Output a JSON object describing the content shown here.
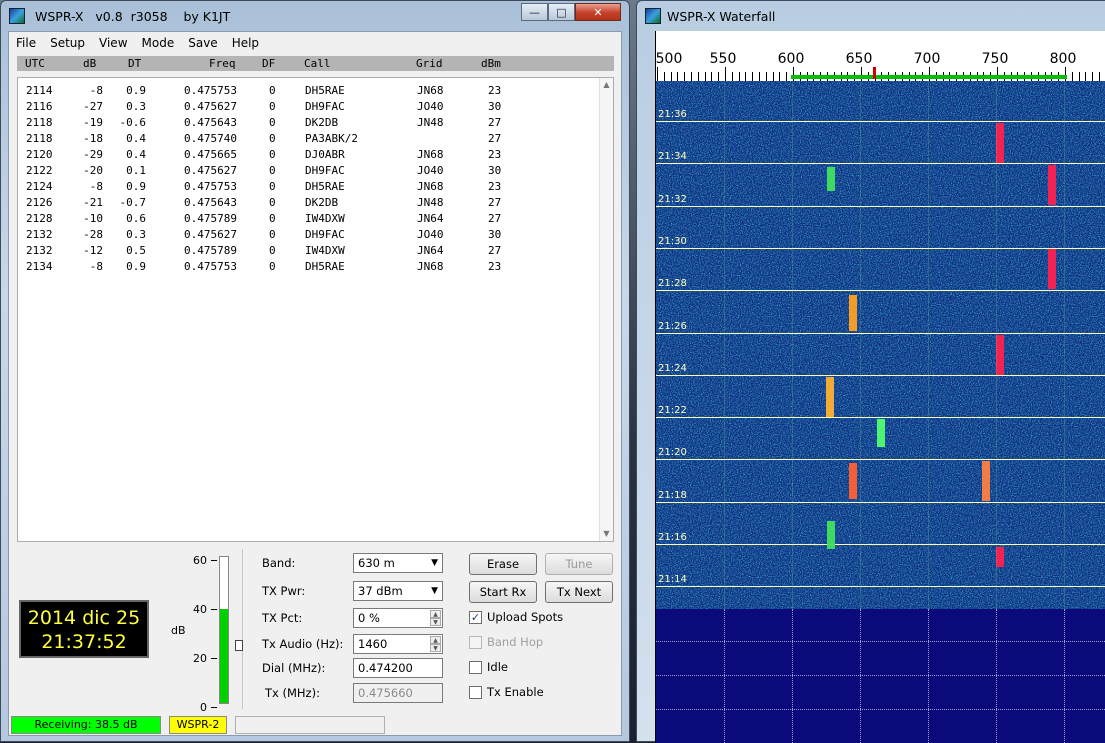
{
  "main_window": {
    "title": "WSPR-X   v0.8  r3058    by K1JT",
    "menu": [
      "File",
      "Setup",
      "View",
      "Mode",
      "Save",
      "Help"
    ],
    "columns": [
      "UTC",
      "dB",
      "DT",
      "Freq",
      "DF",
      "Call",
      "Grid",
      "dBm"
    ],
    "rows": [
      [
        "2114",
        "-8",
        "0.9",
        "0.475753",
        "0",
        "DH5RAE",
        "JN68",
        "23"
      ],
      [
        "2116",
        "-27",
        "0.3",
        "0.475627",
        "0",
        "DH9FAC",
        "JO40",
        "30"
      ],
      [
        "2118",
        "-19",
        "-0.6",
        "0.475643",
        "0",
        "DK2DB",
        "JN48",
        "27"
      ],
      [
        "2118",
        "-18",
        "0.4",
        "0.475740",
        "0",
        "PA3ABK/2",
        "",
        "27"
      ],
      [
        "2120",
        "-29",
        "0.4",
        "0.475665",
        "0",
        "DJ0ABR",
        "JN68",
        "23"
      ],
      [
        "2122",
        "-20",
        "0.1",
        "0.475627",
        "0",
        "DH9FAC",
        "JO40",
        "30"
      ],
      [
        "2124",
        "-8",
        "0.9",
        "0.475753",
        "0",
        "DH5RAE",
        "JN68",
        "23"
      ],
      [
        "2126",
        "-21",
        "-0.7",
        "0.475643",
        "0",
        "DK2DB",
        "JN48",
        "27"
      ],
      [
        "2128",
        "-10",
        "0.6",
        "0.475789",
        "0",
        "IW4DXW",
        "JN64",
        "27"
      ],
      [
        "2132",
        "-28",
        "0.3",
        "0.475627",
        "0",
        "DH9FAC",
        "JO40",
        "30"
      ],
      [
        "2132",
        "-12",
        "0.5",
        "0.475789",
        "0",
        "IW4DXW",
        "JN64",
        "27"
      ],
      [
        "2134",
        "-8",
        "0.9",
        "0.475753",
        "0",
        "DH5RAE",
        "JN68",
        "23"
      ]
    ],
    "clock": {
      "date": "2014 dic 25",
      "time": "21:37:52"
    },
    "meter": {
      "ticks": [
        "60",
        "40",
        "20",
        "0"
      ],
      "unit": "dB",
      "level_db": 38.5,
      "max_db": 60
    },
    "controls": {
      "band_label": "Band:",
      "band_value": "630 m",
      "txpwr_label": "TX Pwr:",
      "txpwr_value": "37 dBm",
      "txpct_label": "TX Pct:",
      "txpct_value": "0  %",
      "txaudio_label": "Tx Audio (Hz):",
      "txaudio_value": "1460",
      "dial_label": "Dial (MHz):",
      "dial_value": "0.474200",
      "tx_label": "Tx (MHz):",
      "tx_value": "0.475660"
    },
    "buttons": {
      "erase": "Erase",
      "tune": "Tune",
      "start_rx": "Start Rx",
      "tx_next": "Tx Next"
    },
    "checkboxes": {
      "upload_spots": {
        "label": "Upload Spots",
        "checked": true
      },
      "band_hop": {
        "label": "Band Hop",
        "checked": false
      },
      "idle": {
        "label": "Idle",
        "checked": false
      },
      "tx_enable": {
        "label": "Tx Enable",
        "checked": false
      }
    },
    "status": {
      "receiving": "Receiving:  38.5 dB",
      "mode": "WSPR-2"
    }
  },
  "waterfall_window": {
    "title": "WSPR-X Waterfall",
    "freq_labels": [
      "500",
      "550",
      "600",
      "650",
      "700",
      "750",
      "800"
    ],
    "time_labels": [
      "21:36",
      "21:34",
      "21:32",
      "21:30",
      "21:28",
      "21:26",
      "21:24",
      "21:22",
      "21:20",
      "21:18",
      "21:16",
      "21:14"
    ]
  },
  "colors": {
    "status_green": "#00ff00",
    "status_yellow": "#ffff00",
    "clock_text": "#ffff40",
    "waterfall_bg": "#103080",
    "signal_red": "#ff2050"
  }
}
